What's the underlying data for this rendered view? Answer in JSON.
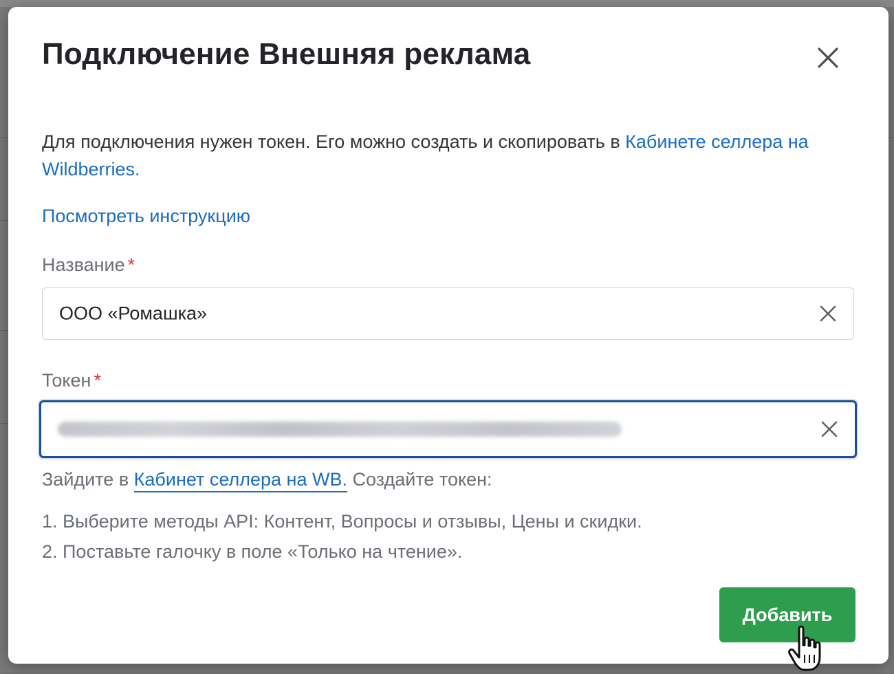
{
  "dialog": {
    "title": "Подключение Внешняя реклама",
    "description_text": "Для подключения нужен токен. Его можно создать и скопировать в ",
    "description_link": "Кабинете селлера на Wildberries.",
    "instruction_link": "Посмотреть инструкцию"
  },
  "fields": {
    "name": {
      "label": "Название",
      "required_mark": "*",
      "value": "ООО «Ромашка»"
    },
    "token": {
      "label": "Токен",
      "required_mark": "*",
      "value_hidden": true
    }
  },
  "hint": {
    "prefix": "Зайдите в ",
    "link": "Кабинет селлера на WB.",
    "suffix": " Создайте токен:"
  },
  "steps": [
    "1. Выберите методы API: Контент, Вопросы и отзывы, Цены и скидки.",
    "2. Поставьте галочку в поле «Только на чтение»."
  ],
  "buttons": {
    "add": "Добавить"
  },
  "colors": {
    "accent_link": "#1a6dbf",
    "primary_button": "#2e9d4e",
    "required": "#d23b3b",
    "focus_border": "#1b4f9c"
  },
  "icons": {
    "close": "close-icon",
    "clear": "clear-icon",
    "cursor": "hand-pointer-icon"
  }
}
